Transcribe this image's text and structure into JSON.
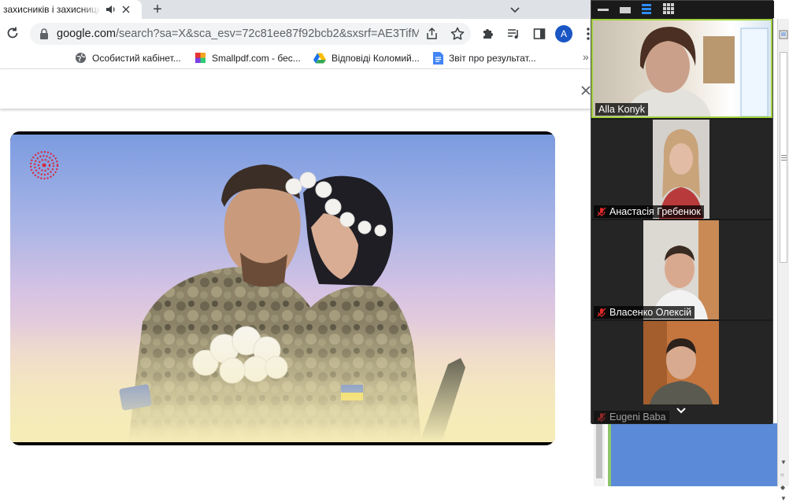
{
  "browser": {
    "tab": {
      "title": "захисників і захисниць"
    },
    "address": {
      "host": "google.com",
      "path": "/search?sa=X&sca_esv=72c81ee87f92bcb2&sxsrf=AE3TifMcj..."
    },
    "profile_initial": "A",
    "bookmarks": [
      {
        "label": "Особистий кабінет..."
      },
      {
        "label": "Smallpdf.com - бес..."
      },
      {
        "label": "Відповіді Коломий..."
      },
      {
        "label": "Звіт про результат..."
      }
    ],
    "bookmarks_more": "»"
  },
  "zoom": {
    "participants": [
      {
        "name": "Alla Konyk",
        "muted": false,
        "active_speaker": true
      },
      {
        "name": "Анастасія Гребенюк",
        "muted": true
      },
      {
        "name": "Власенко Олексій",
        "muted": true
      },
      {
        "name": "Eugeni Baba",
        "muted": true
      }
    ]
  },
  "colors": {
    "zoom_bg": "#1a1a1a",
    "active_speaker_border": "#9fd13b",
    "mute_red": "#e02828",
    "chrome_blue": "#1a73e8"
  }
}
